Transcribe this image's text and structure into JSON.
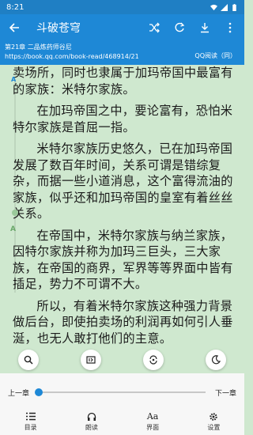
{
  "status_bar": {
    "time": "8:21"
  },
  "toolbar": {
    "title": "斗破苍穹"
  },
  "info": {
    "chapter": "第21章 二品炼药师谷尼",
    "url": "https://book.qq.com/book-read/468914/21",
    "source": "QQ阅读（同）"
  },
  "content": {
    "paragraphs": [
      "卖场所，同时也隶属于加玛帝国中最富有的家族：米特尔家族。",
      "在加玛帝国之中，要论富有，恐怕米特尔家族是首屈一指。",
      "米特尔家族历史悠久，已在加玛帝国发展了数百年时间，关系可谓是错综复杂，而据一些小道消息，这个富得流油的家族，似乎还和加玛帝国的皇室有着丝丝关系。",
      "在帝国中，米特尔家族与纳兰家族，因特尔家族并称为加玛三巨头，三大家族，在帝国的商界，军界等等界面中皆有插足，势力不可谓不大。",
      "所以，有着米特尔家族这种强力背景做后台，即使拍卖场的利润再如何引人垂涎，也无人敢打他们的主意。"
    ]
  },
  "progress": {
    "prev_label": "上一章",
    "next_label": "下一章",
    "value": 0.0
  },
  "menu": [
    {
      "label": "目录",
      "icon": "list-icon"
    },
    {
      "label": "朗读",
      "icon": "headphones-icon"
    },
    {
      "label": "界面",
      "icon": "font-icon"
    },
    {
      "label": "设置",
      "icon": "gear-icon"
    }
  ],
  "colors": {
    "primary": "#1e88d6",
    "page_bg": "#cfe8cf"
  }
}
